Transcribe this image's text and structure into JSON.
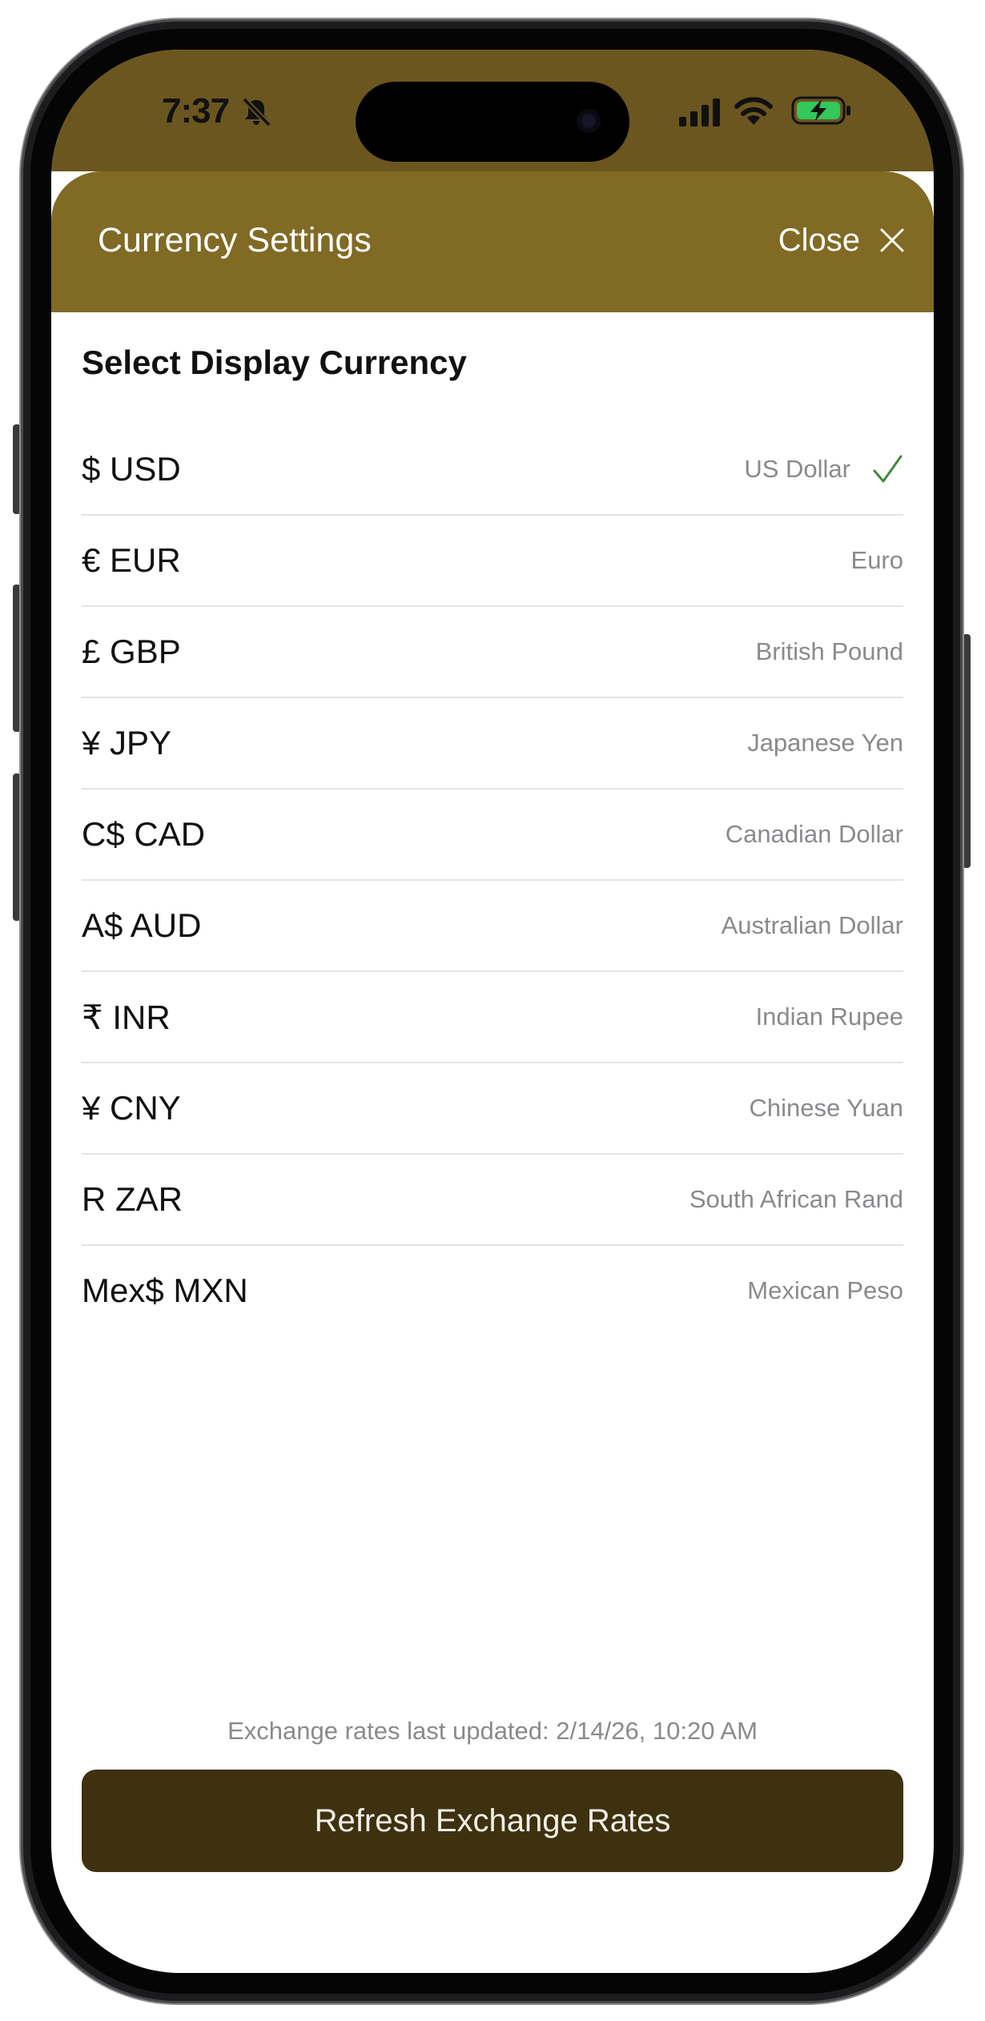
{
  "status_bar": {
    "time": "7:37",
    "icons": [
      "bell-slash-icon",
      "cellular-signal-icon",
      "wifi-icon",
      "battery-charging-icon"
    ]
  },
  "header": {
    "title": "Currency Settings",
    "close_label": "Close",
    "close_icon": "close-icon"
  },
  "section_title": "Select Display Currency",
  "currencies": [
    {
      "code": "$ USD",
      "name": "US Dollar",
      "selected": true
    },
    {
      "code": "€ EUR",
      "name": "Euro",
      "selected": false
    },
    {
      "code": "£ GBP",
      "name": "British Pound",
      "selected": false
    },
    {
      "code": "¥ JPY",
      "name": "Japanese Yen",
      "selected": false
    },
    {
      "code": "C$ CAD",
      "name": "Canadian Dollar",
      "selected": false
    },
    {
      "code": "A$ AUD",
      "name": "Australian Dollar",
      "selected": false
    },
    {
      "code": "₹ INR",
      "name": "Indian Rupee",
      "selected": false
    },
    {
      "code": "¥ CNY",
      "name": "Chinese Yuan",
      "selected": false
    },
    {
      "code": "R ZAR",
      "name": "South African Rand",
      "selected": false
    },
    {
      "code": "Mex$ MXN",
      "name": "Mexican Peso",
      "selected": false
    }
  ],
  "footer": {
    "updated_text": "Exchange rates last updated: 2/14/26, 10:20 AM",
    "refresh_label": "Refresh Exchange Rates"
  },
  "colors": {
    "status_bar": "#6b561f",
    "header": "#806a24",
    "refresh_button": "#3e3110",
    "check_mark": "#3f8a3f",
    "battery_fill": "#34c759"
  }
}
